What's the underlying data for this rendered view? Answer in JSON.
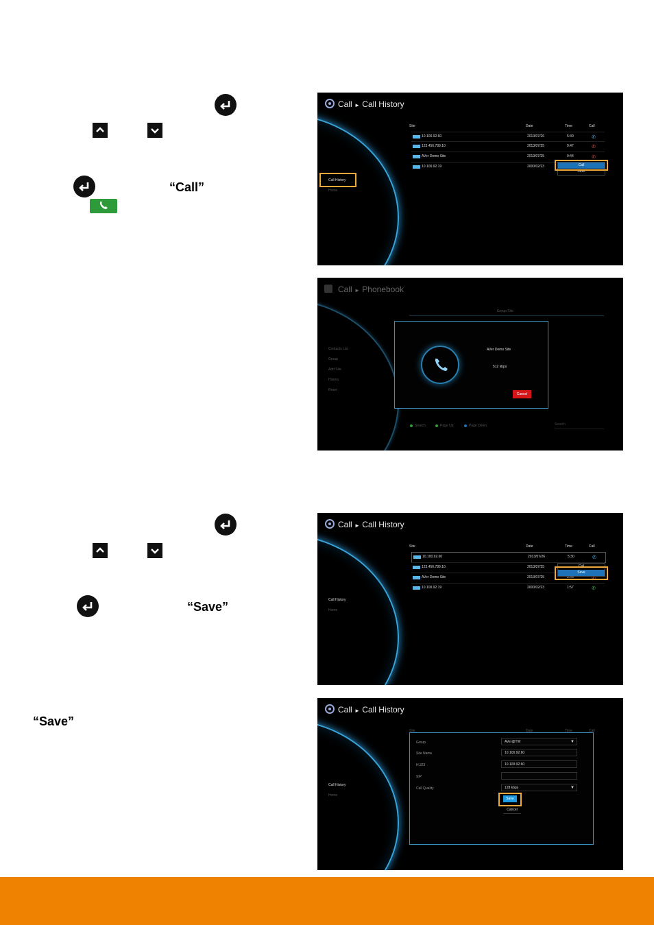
{
  "step1": {
    "quote_call": "“Call”"
  },
  "step2": {
    "quote_save": "“Save”",
    "quote_save_note": "“Save”"
  },
  "screens": {
    "call_history_1": {
      "nav_call": "Call",
      "nav_arrow": "►",
      "nav_page": "Call History",
      "menu": [
        "Call History",
        "Home"
      ],
      "columns": [
        "Site",
        "Date",
        "Time",
        "Call"
      ],
      "rows": [
        {
          "site": "10.100.92.60",
          "date": "2013/07/26",
          "time": "5:30"
        },
        {
          "site": "123.456.789.10",
          "date": "2013/07/25",
          "time": "9:47"
        },
        {
          "site": "AVer Demo Site",
          "date": "2013/07/25",
          "time": "9:44"
        },
        {
          "site": "10.100.92.19",
          "date": "2000/02/23",
          "time": ""
        }
      ],
      "popup": [
        "Call",
        "Save"
      ]
    },
    "phonebook": {
      "nav_call": "Call",
      "nav_arrow": "►",
      "nav_page": "Phonebook",
      "menu": [
        "Contacts List",
        "Group",
        "Add Site",
        "History",
        "Reset"
      ],
      "tabs": "Group Site",
      "dialog_site": "AVer Demo Site",
      "dialog_rate": "512 kbps",
      "cancel": "Cancel",
      "footer": [
        "Search",
        "Page Up",
        "Page Down"
      ],
      "search_placeholder": "Search"
    },
    "call_history_2": {
      "nav_call": "Call",
      "nav_arrow": "►",
      "nav_page": "Call History",
      "menu": [
        "Call History",
        "Home"
      ],
      "columns": [
        "Site",
        "Date",
        "Time",
        "Call"
      ],
      "rows": [
        {
          "site": "10.100.92.60",
          "date": "2013/07/26",
          "time": "5:30"
        },
        {
          "site": "123.456.789.10",
          "date": "2013/07/25",
          "time": ""
        },
        {
          "site": "AVer Demo Site",
          "date": "2013/07/25",
          "time": "9:44"
        },
        {
          "site": "10.100.92.19",
          "date": "2000/02/23",
          "time": "1:57"
        }
      ],
      "popup": [
        "Call",
        "Save"
      ]
    },
    "save_form": {
      "nav_call": "Call",
      "nav_arrow": "►",
      "nav_page": "Call History",
      "menu": [
        "Call History",
        "Home"
      ],
      "columns": [
        "Site",
        "Date",
        "Time",
        "Call"
      ],
      "fields": [
        {
          "label": "Group",
          "value": "AVer@TW"
        },
        {
          "label": "Site Name",
          "value": "10.100.92.60"
        },
        {
          "label": "H.323",
          "value": "10.100.92.60"
        },
        {
          "label": "SIP",
          "value": ""
        },
        {
          "label": "Call Quality",
          "value": "128 kbps"
        }
      ],
      "save": "Save",
      "cancel": "Cancel"
    }
  },
  "colors": {
    "accent_orange": "#ef8200",
    "highlight": "#f2a93b",
    "select_blue": "#1e73b8",
    "call_green": "#2e9b3a"
  }
}
